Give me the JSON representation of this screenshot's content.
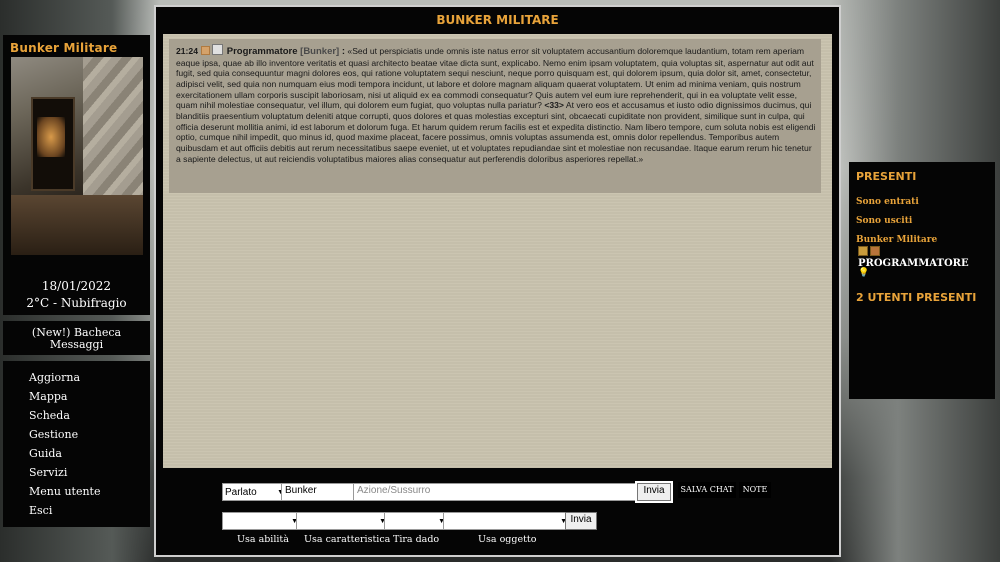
{
  "left_panel": {
    "title": "Bunker Militare",
    "date": "18/01/2022",
    "weather": "2°C - Nubifragio"
  },
  "board": {
    "line1": "(New!) Bacheca",
    "line2": "Messaggi"
  },
  "menu": [
    "Aggiorna",
    "Mappa",
    "Scheda",
    "Gestione",
    "Guida",
    "Servizi",
    "Menu utente",
    "Esci"
  ],
  "chat": {
    "title": "BUNKER MILITARE",
    "message": {
      "time": "21:24",
      "author": "Programmatore",
      "location": "[Bunker]",
      "sep": ":",
      "text_before": "«Sed ut perspiciatis unde omnis iste natus error sit voluptatem accusantium doloremque laudantium, totam rem aperiam eaque ipsa, quae ab illo inventore veritatis et quasi architecto beatae vitae dicta sunt, explicabo. Nemo enim ipsam voluptatem, quia voluptas sit, aspernatur aut odit aut fugit, sed quia consequuntur magni dolores eos, qui ratione voluptatem sequi nesciunt, neque porro quisquam est, qui dolorem ipsum, quia dolor sit, amet, consectetur, adipisci velit, sed quia non numquam eius modi tempora incidunt, ut labore et dolore magnam aliquam quaerat voluptatem. Ut enim ad minima veniam, quis nostrum exercitationem ullam corporis suscipit laboriosam, nisi ut aliquid ex ea commodi consequatur? Quis autem vel eum iure reprehenderit, qui in ea voluptate velit esse, quam nihil molestiae consequatur, vel illum, qui dolorem eum fugiat, quo voluptas nulla pariatur?",
      "highlight": "<33>",
      "text_after": "At vero eos et accusamus et iusto odio dignissimos ducimus, qui blanditiis praesentium voluptatum deleniti atque corrupti, quos dolores et quas molestias excepturi sint, obcaecati cupiditate non provident, similique sunt in culpa, qui officia deserunt mollitia animi, id est laborum et dolorum fuga. Et harum quidem rerum facilis est et expedita distinctio. Nam libero tempore, cum soluta nobis est eligendi optio, cumque nihil impedit, quo minus id, quod maxime placeat, facere possimus, omnis voluptas assumenda est, omnis dolor repellendus. Temporibus autem quibusdam et aut officiis debitis aut rerum necessitatibus saepe eveniet, ut et voluptates repudiandae sint et molestiae non recusandae. Itaque earum rerum hic tenetur a sapiente delectus, ut aut reiciendis voluptatibus maiores alias consequatur aut perferendis doloribus asperiores repellat.»"
    }
  },
  "controls": {
    "type_select": "Parlato",
    "tag_value": "Bunker",
    "action_placeholder": "Azione/Sussurro",
    "send_label": "Invia",
    "save_chat_label": "SALVA CHAT",
    "notes_label": "NOTE",
    "send2_label": "Invia",
    "labels": {
      "ability": "Usa abilità",
      "characteristic": "Usa caratteristica",
      "dice": "Tira dado",
      "object": "Usa oggetto"
    }
  },
  "right_panel": {
    "title": "PRESENTI",
    "entered": "Sono entrati",
    "exited": "Sono usciti",
    "location": "Bunker Militare",
    "user": "PROGRAMMATORE",
    "count": "2 UTENTI PRESENTI"
  },
  "colors": {
    "accent": "#e8a33a",
    "panel_bg": "#050505",
    "chat_bg": "#c9c3af",
    "message_bg": "#a7a090"
  }
}
